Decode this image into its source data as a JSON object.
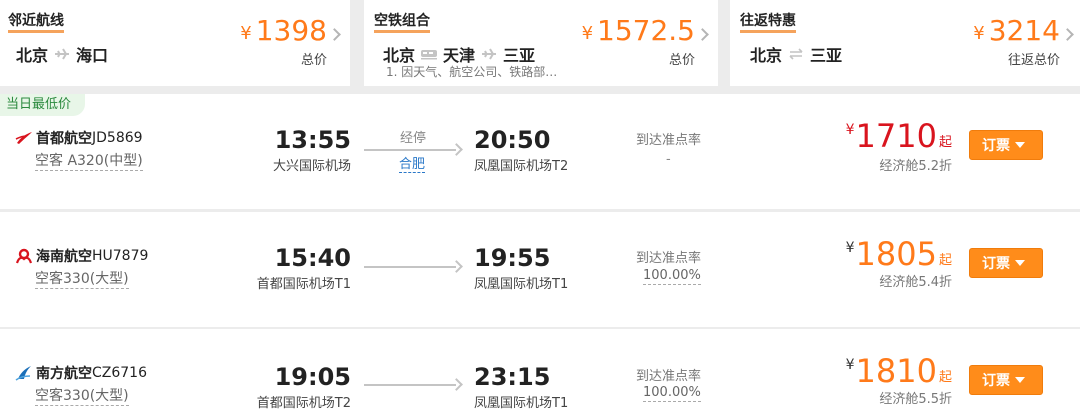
{
  "colors": {
    "accent": "#ff7a1a",
    "red_price": "#d9141e",
    "book_button": "#ff8c1a",
    "link": "#2a78c8"
  },
  "top_cards": [
    {
      "title": "邻近航线",
      "from": "北京",
      "sep_icon": "plane-icon",
      "to": "海口",
      "currency": "¥",
      "price": "1398",
      "price_label": "总价"
    },
    {
      "title": "空铁组合",
      "from": "北京",
      "via": "天津",
      "to": "三亚",
      "currency": "¥",
      "price": "1572.5",
      "price_label": "总价",
      "note": "1. 因天气、航空公司、铁路部…"
    },
    {
      "title": "往返特惠",
      "from": "北京",
      "sep_icon": "roundtrip-icon",
      "to": "三亚",
      "currency": "¥",
      "price": "3214",
      "price_label": "往返总价"
    }
  ],
  "flights": [
    {
      "badge": "当日最低价",
      "airline": "首都航空",
      "flight_no": "JD5869",
      "logo": "capital-airlines-logo",
      "plane": "空客 A320(中型)",
      "dep_time": "13:55",
      "dep_airport": "大兴国际机场",
      "stop_label": "经停",
      "stop_city": "合肥",
      "arr_time": "20:50",
      "arr_airport": "凤凰国际机场T2",
      "ontime_label": "到达准点率",
      "ontime": "-",
      "currency": "¥",
      "price": "1710",
      "price_suffix": "起",
      "discount": "经济舱5.2折",
      "price_color": "#d9141e",
      "book_label": "订票"
    },
    {
      "airline": "海南航空",
      "flight_no": "HU7879",
      "logo": "hainan-airlines-logo",
      "plane": "空客330(大型)",
      "dep_time": "15:40",
      "dep_airport": "首都国际机场T1",
      "arr_time": "19:55",
      "arr_airport": "凤凰国际机场T1",
      "ontime_label": "到达准点率",
      "ontime": "100.00%",
      "currency": "¥",
      "price": "1805",
      "price_suffix": "起",
      "discount": "经济舱5.4折",
      "price_color": "#ff7a1a",
      "book_label": "订票"
    },
    {
      "airline": "南方航空",
      "flight_no": "CZ6716",
      "logo": "china-southern-logo",
      "plane": "空客330(大型)",
      "dep_time": "19:05",
      "dep_airport": "首都国际机场T2",
      "arr_time": "23:15",
      "arr_airport": "凤凰国际机场T1",
      "ontime_label": "到达准点率",
      "ontime": "100.00%",
      "currency": "¥",
      "price": "1810",
      "price_suffix": "起",
      "discount": "经济舱5.5折",
      "price_color": "#ff7a1a",
      "book_label": "订票"
    }
  ]
}
